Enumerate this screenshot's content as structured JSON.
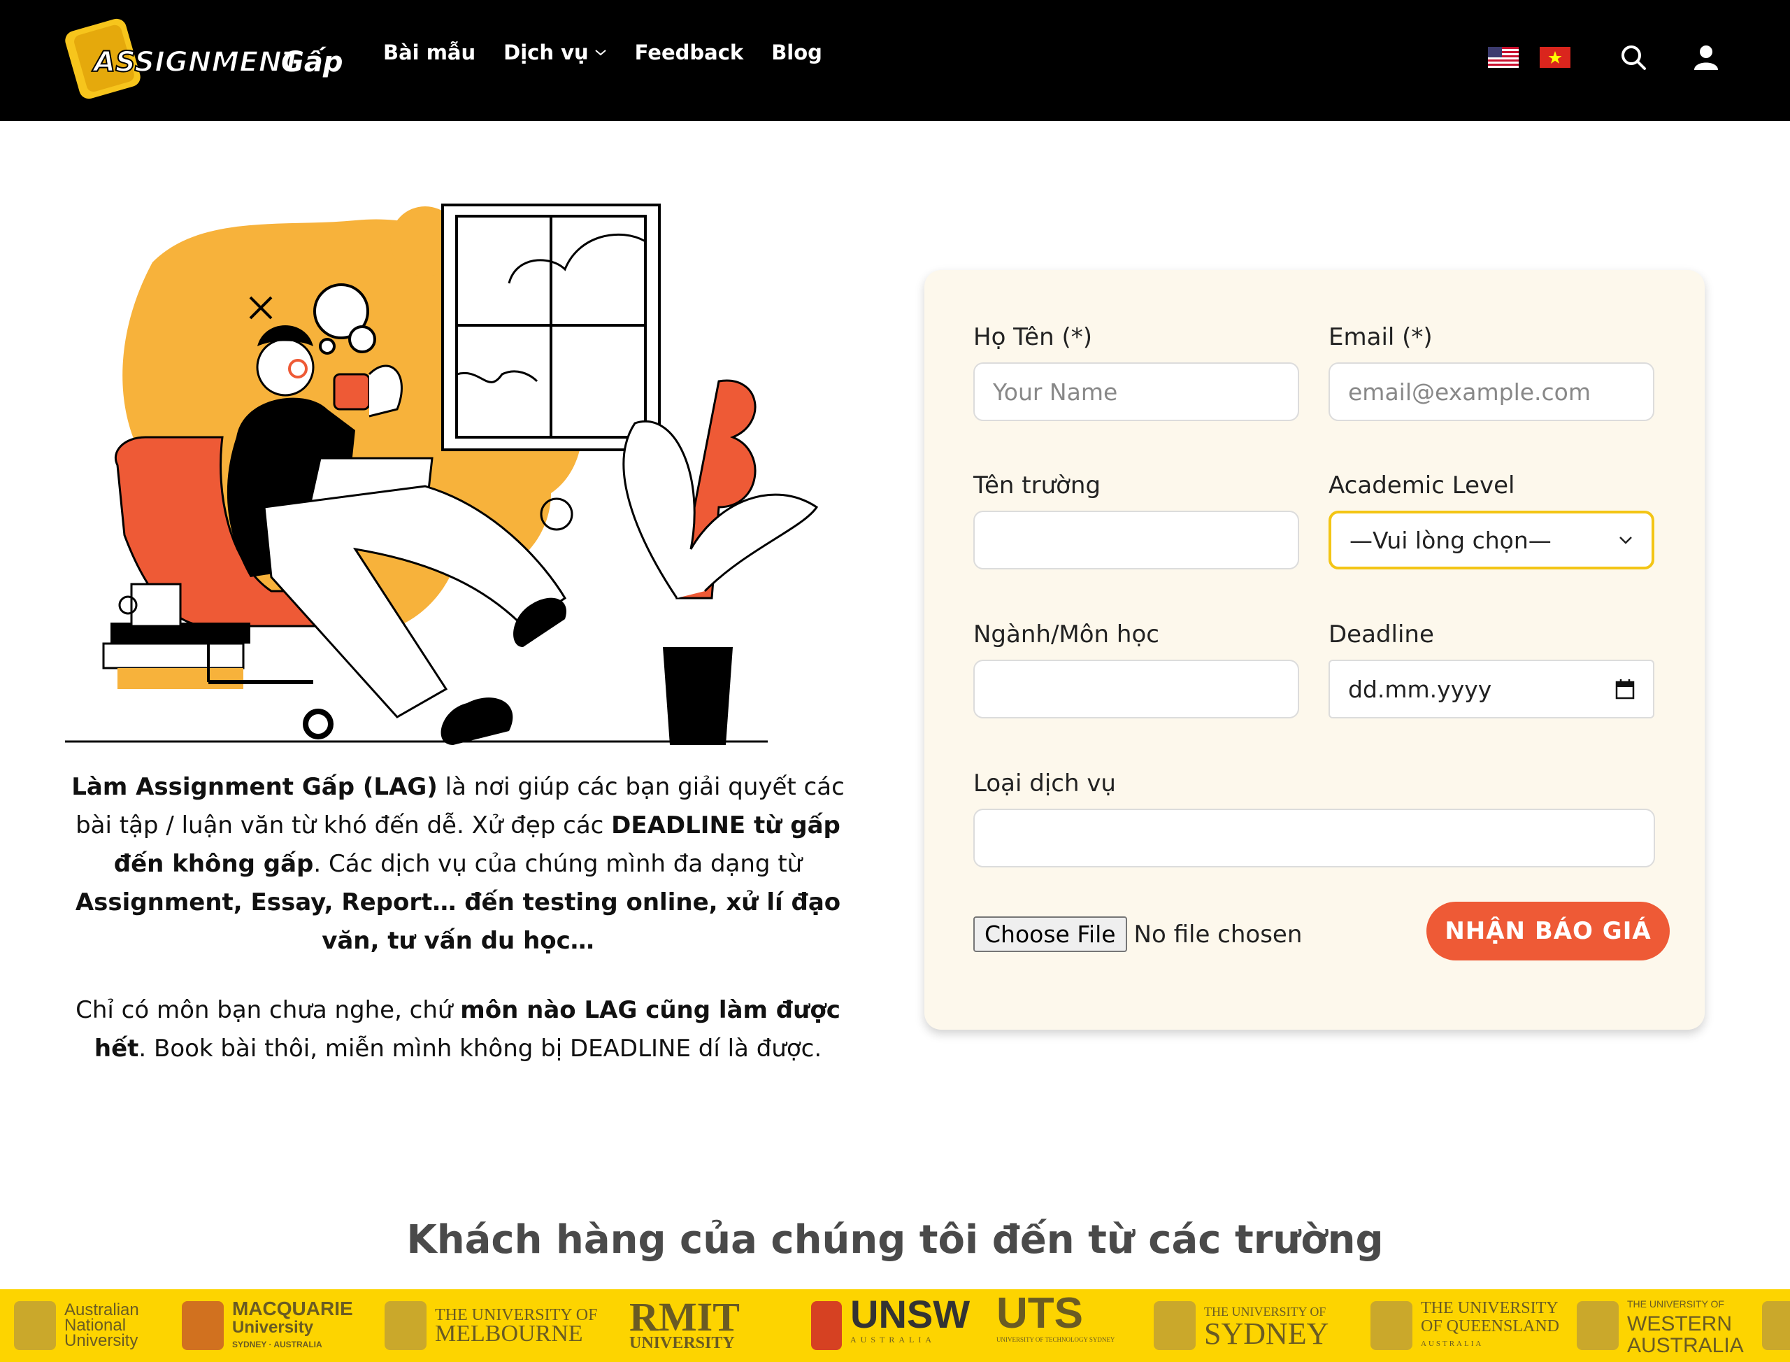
{
  "header": {
    "logo_text": "ASSIGNMENT Gấp",
    "nav": [
      {
        "label": "Bài mẫu"
      },
      {
        "label": "Dịch vụ"
      },
      {
        "label": "Feedback"
      },
      {
        "label": "Blog"
      }
    ],
    "icons": [
      "us-flag-icon",
      "vn-flag-icon",
      "search-icon",
      "user-icon"
    ]
  },
  "intro": {
    "p1_b1": "Làm Assignment Gấp (LAG)",
    "p1_t1": " là nơi giúp các bạn giải quyết các bài tập / luận văn từ khó đến dễ. Xử đẹp các ",
    "p1_b2": "DEADLINE từ gấp đến không gấp",
    "p1_t2": ". Các dịch vụ của chúng mình đa dạng từ ",
    "p1_b3": "Assignment, Essay, Report… đến testing online, xử lí đạo văn, tư vấn du học…",
    "p2_t1": "Chỉ có môn bạn chưa nghe, chứ ",
    "p2_b1": "môn nào LAG cũng làm được hết",
    "p2_t2": ". Book bài thôi, miễn mình không bị DEADLINE dí là được."
  },
  "form": {
    "name_label": "Họ Tên (*)",
    "name_placeholder": "Your Name",
    "email_label": "Email (*)",
    "email_placeholder": "email@example.com",
    "school_label": "Tên trường",
    "school_value": "",
    "level_label": "Academic Level",
    "level_value": "—Vui lòng chọn—",
    "major_label": "Ngành/Môn học",
    "major_value": "",
    "deadline_label": "Deadline",
    "deadline_placeholder": "dd.mm.yyyy",
    "service_label": "Loại dịch vụ",
    "service_value": "",
    "file_button": "Choose File",
    "file_status": "No file chosen",
    "submit_label": "NHẬN BÁO GIÁ"
  },
  "clients": {
    "title": "Khách hàng của chúng tôi đến từ các trường",
    "universities": [
      {
        "l1": "Australian",
        "l2": "National",
        "l3": "University"
      },
      {
        "l1": "MACQUARIE",
        "l2": "University",
        "l3": "SYDNEY · AUSTRALIA"
      },
      {
        "l1": "THE UNIVERSITY OF",
        "l2": "MELBOURNE"
      },
      {
        "l1": "RMIT",
        "l2": "UNIVERSITY"
      },
      {
        "l1": "UNSW",
        "l2": "AUSTRALIA"
      },
      {
        "l1": "UTS",
        "l2": "UNIVERSITY OF TECHNOLOGY SYDNEY"
      },
      {
        "l1": "THE UNIVERSITY OF",
        "l2": "SYDNEY"
      },
      {
        "l1": "THE UNIVERSITY",
        "l2": "OF QUEENSLAND",
        "l3": "AUSTRALIA"
      },
      {
        "l1": "THE UNIVERSITY OF",
        "l2": "WESTERN",
        "l3": "AUSTRALIA"
      }
    ]
  },
  "colors": {
    "accent": "#ee5a36",
    "brand_yellow": "#fdd400",
    "illustration_orange": "#f7b23b",
    "form_bg": "#fdf8ec"
  }
}
